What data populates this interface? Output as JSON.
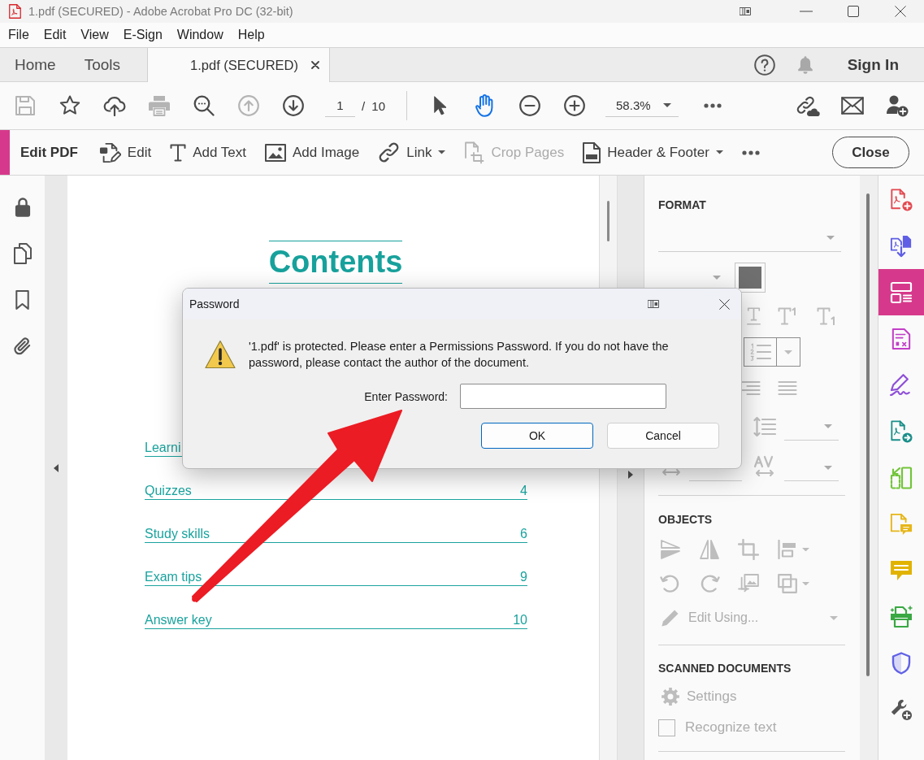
{
  "window": {
    "title": "1.pdf (SECURED) - Adobe Acrobat Pro DC (32-bit)"
  },
  "menu": [
    "File",
    "Edit",
    "View",
    "E-Sign",
    "Window",
    "Help"
  ],
  "tabs": [
    {
      "label": "Home",
      "selected": false,
      "closable": false
    },
    {
      "label": "Tools",
      "selected": false,
      "closable": false
    },
    {
      "label": "1.pdf (SECURED)",
      "selected": true,
      "closable": true
    }
  ],
  "account": {
    "sign_in": "Sign In"
  },
  "toolbar": {
    "actions": [
      {
        "kind": "save",
        "disabled": true
      },
      {
        "kind": "bookmark-star",
        "disabled": false
      },
      {
        "kind": "upload",
        "disabled": false
      },
      {
        "kind": "print",
        "disabled": true
      },
      {
        "kind": "find",
        "disabled": false
      },
      {
        "kind": "previous-page",
        "disabled": true
      },
      {
        "kind": "next-page",
        "disabled": false
      }
    ],
    "page": {
      "value": "1",
      "total": "/ 10"
    },
    "modes": [
      {
        "kind": "select",
        "selected": false
      },
      {
        "kind": "hand",
        "selected": true
      }
    ],
    "zoom": {
      "value": "58.3%"
    }
  },
  "edit_bar": {
    "title": "Edit PDF",
    "tools": [
      {
        "kind": "edit",
        "label": "Edit",
        "disabled": false,
        "has_menu": false
      },
      {
        "kind": "add-text",
        "label": "Add Text",
        "disabled": false,
        "has_menu": false
      },
      {
        "kind": "add-image",
        "label": "Add Image",
        "disabled": false,
        "has_menu": false
      },
      {
        "kind": "link",
        "label": "Link",
        "disabled": false,
        "has_menu": true
      },
      {
        "kind": "crop",
        "label": "Crop Pages",
        "disabled": true,
        "has_menu": false
      },
      {
        "kind": "header-footer",
        "label": "Header & Footer",
        "disabled": false,
        "has_menu": true
      }
    ],
    "close": "Close"
  },
  "document": {
    "heading": "Contents",
    "entries": [
      {
        "title": "Learni"
      },
      {
        "title": "Quizzes",
        "page": "4"
      },
      {
        "title": "Study skills",
        "page": "6"
      },
      {
        "title": "Exam tips",
        "page": "9"
      },
      {
        "title": "Answer key",
        "page": "10"
      }
    ]
  },
  "properties": {
    "format": {
      "heading": "FORMAT",
      "disabled": true,
      "swatch": {
        "color": "#6f6f6f"
      }
    },
    "objects": {
      "heading": "OBJECTS",
      "disabled": true,
      "edit_using": "Edit Using..."
    },
    "scanned": {
      "heading": "SCANNED DOCUMENTS",
      "disabled": true,
      "settings": "Settings",
      "recognize": {
        "label": "Recognize text",
        "checked": false
      }
    }
  },
  "tools_strip": [
    {
      "kind": "create-pdf",
      "selected": false
    },
    {
      "kind": "export-pdf",
      "selected": false
    },
    {
      "kind": "edit-pdf",
      "selected": true
    },
    {
      "kind": "prepare-form",
      "selected": false
    },
    {
      "kind": "fill-sign",
      "selected": false
    },
    {
      "kind": "send-pdf",
      "selected": false
    },
    {
      "kind": "compare",
      "selected": false
    },
    {
      "kind": "comment-doc",
      "selected": false
    },
    {
      "kind": "comment",
      "selected": false
    },
    {
      "kind": "print-production",
      "selected": false
    },
    {
      "kind": "protect",
      "selected": false
    },
    {
      "kind": "more-tools",
      "selected": false
    }
  ],
  "dialog": {
    "title": "Password",
    "message": "'1.pdf' is protected. Please enter a Permissions Password. If you do not have the password, please contact the author of the document.",
    "field": {
      "label": "Enter Password:"
    },
    "buttons": [
      {
        "label": "OK",
        "default": true
      },
      {
        "label": "Cancel",
        "default": false
      }
    ]
  },
  "annotation": {
    "kind": "arrow"
  }
}
